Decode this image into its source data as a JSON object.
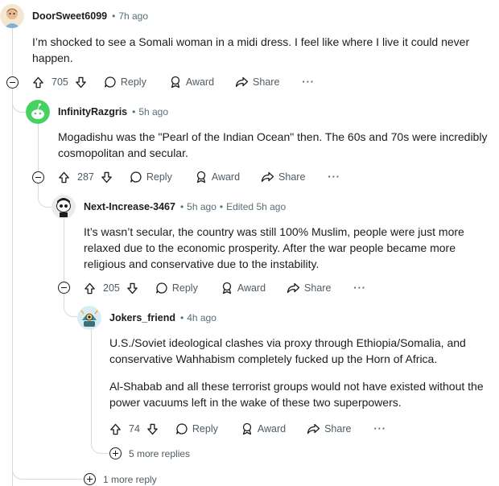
{
  "comments": [
    {
      "author": "DoorSweet6099",
      "time": "7h ago",
      "avatar_icon": "illustrated-avatar-icon",
      "body": [
        "I’m shocked to see a Somali woman in a midi dress. I feel like where I live it could never happen."
      ],
      "score": "705"
    },
    {
      "author": "InfinityRazgris",
      "time": "5h ago",
      "avatar_icon": "green-snoo-avatar-icon",
      "body": [
        "Mogadishu was the \"Pearl of the Indian Ocean\" then. The 60s and 70s were incredibly cosmopolitan and secular."
      ],
      "score": "287"
    },
    {
      "author": "Next-Increase-3467",
      "time": "5h ago",
      "edited": "Edited 5h ago",
      "avatar_icon": "skull-snoo-avatar-icon",
      "body": [
        "It’s wasn’t secular, the country was still 100% Muslim, people were just more relaxed due to the economic prosperity. After the war people became more religious and conservative due to the instability."
      ],
      "score": "205"
    },
    {
      "author": "Jokers_friend",
      "time": "4h ago",
      "avatar_icon": "robot-avatar-icon",
      "body": [
        "U.S./Soviet ideological clashes via proxy through Ethiopia/Somalia, and conservative Wahhabism completely fucked up the Horn of Africa.",
        "Al-Shabab and all these terrorist groups would not have existed without the power vacuums left in the wake of these two superpowers."
      ],
      "score": "74"
    }
  ],
  "actions": {
    "reply": "Reply",
    "award": "Award",
    "share": "Share",
    "overflow": "···"
  },
  "more_replies": {
    "nested": "5 more replies",
    "outer": "1 more reply"
  },
  "colors": {
    "thread_line": "#d7dadc",
    "meta_text": "#576f76",
    "action_text": "#4f5b62"
  }
}
